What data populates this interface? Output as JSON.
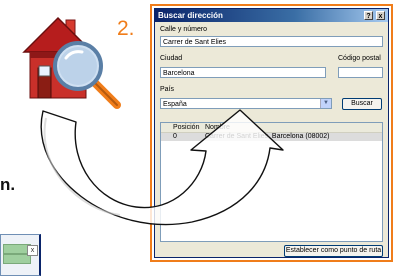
{
  "step_number": "2.",
  "partial_text": "n.",
  "dialog": {
    "title": "Buscar dirección",
    "help_button": "?",
    "close_button": "x",
    "street_label": "Calle y número",
    "street_value": "Carrer de Sant Elies",
    "city_label": "Ciudad",
    "city_value": "Barcelona",
    "postal_label": "Código postal",
    "postal_value": "",
    "country_label": "País",
    "country_value": "España",
    "search_button": "Buscar",
    "results": {
      "columns": [
        "Posición",
        "Nombre"
      ],
      "rows": [
        {
          "position": "0",
          "name": "Carrer de Sant Elies, Barcelona (08002)"
        }
      ]
    },
    "route_button": "Establecer como punto de ruta"
  },
  "bottom_left_window": {
    "close_label": "x"
  },
  "colors": {
    "accent_orange": "#f07d1a",
    "house_red": "#b61d1d",
    "titlebar_blue": "#0a246a",
    "dialog_bg": "#ece9d8"
  },
  "icons": [
    "house-search-icon",
    "curved-arrow-icon",
    "magnifier-icon"
  ]
}
